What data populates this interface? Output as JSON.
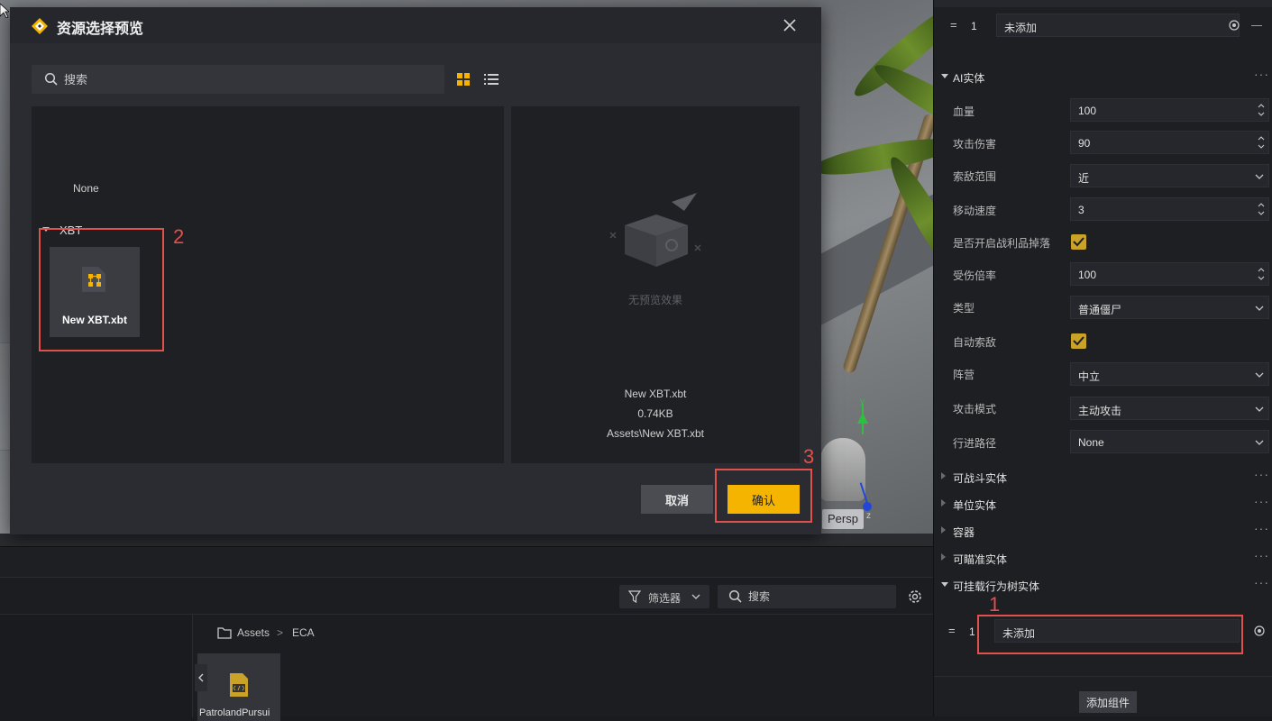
{
  "dialog": {
    "title": "资源选择预览",
    "search_placeholder": "搜索",
    "none_label": "None",
    "group_label": "XBT",
    "file_name": "New XBT.xbt",
    "preview_empty_text": "无预览效果",
    "preview_name": "New XBT.xbt",
    "preview_size": "0.74KB",
    "preview_path": "Assets\\New XBT.xbt",
    "cancel_label": "取消",
    "confirm_label": "确认",
    "accent_color": "#f5b400"
  },
  "annotations": {
    "one": "1",
    "two": "2",
    "three": "3",
    "color": "#e2504b"
  },
  "scene": {
    "view_label": "Persp",
    "axis_y": "y",
    "axis_z": "z"
  },
  "bottom": {
    "filter_label": "筛选器",
    "search_placeholder": "搜索",
    "crumb_root": "Assets",
    "crumb_sep": ">",
    "crumb_child": "ECA",
    "asset_name": "PatrolandPursui"
  },
  "inspector": {
    "top_slot": {
      "handle": "=",
      "index": "1",
      "value": "未添加"
    },
    "ai_section": "AI实体",
    "props": {
      "hp_label": "血量",
      "hp_value": "100",
      "atk_label": "攻击伤害",
      "atk_value": "90",
      "search_range_label": "索敌范围",
      "search_range_value": "近",
      "speed_label": "移动速度",
      "speed_value": "3",
      "loot_label": "是否开启战利品掉落",
      "dmg_rate_label": "受伤倍率",
      "dmg_rate_value": "100",
      "type_label": "类型",
      "type_value": "普通僵尸",
      "auto_search_label": "自动索敌",
      "camp_label": "阵营",
      "camp_value": "中立",
      "atk_mode_label": "攻击模式",
      "atk_mode_value": "主动攻击",
      "path_label": "行进路径",
      "path_value": "None"
    },
    "sections": {
      "combat": "可战斗实体",
      "unit": "单位实体",
      "container": "容器",
      "aimable": "可瞄准实体",
      "bt_entity": "可挂载行为树实体"
    },
    "bt_slot": {
      "handle": "=",
      "index": "1",
      "value": "未添加"
    },
    "add_component_label": "添加组件",
    "more_label": "···"
  }
}
